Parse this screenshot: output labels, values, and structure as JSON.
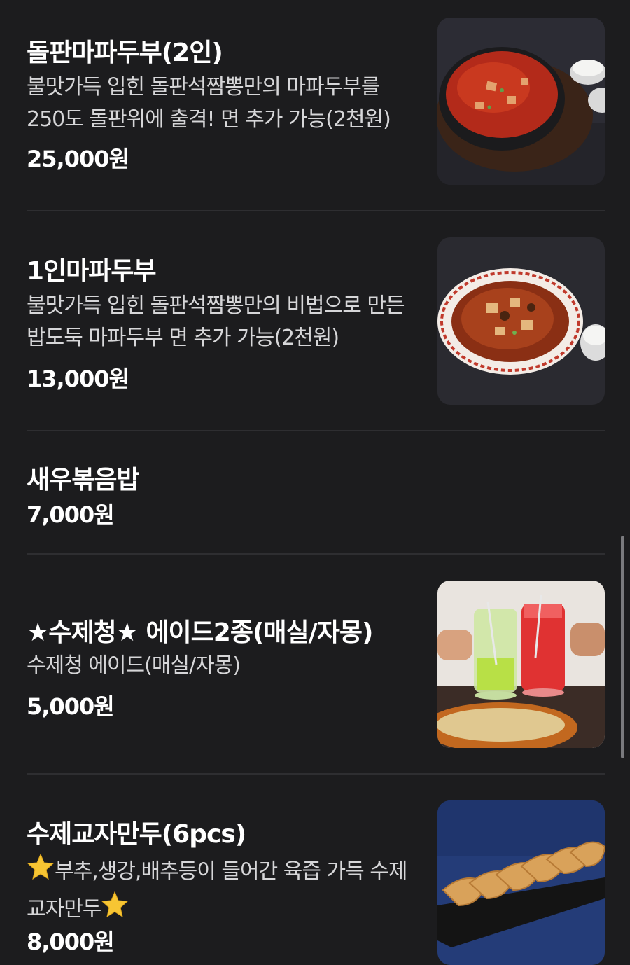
{
  "items": [
    {
      "title": "돌판마파두부(2인)",
      "description": "불맛가득 입힌 돌판석짬뽕만의 마파두부를 250도 돌판위에 출격! 면 추가 가능(2천원)",
      "price": "25,000원",
      "image_icon": "mapo-tofu-stone-pot-photo"
    },
    {
      "title": "1인마파두부",
      "description": "불맛가득 입힌 돌판석짬뽕만의 비법으로 만든 밥도둑 마파두부 면 추가 가능(2천원)",
      "price": "13,000원",
      "image_icon": "mapo-tofu-bowl-photo"
    },
    {
      "title": "새우볶음밥",
      "price": "7,000원"
    },
    {
      "title": "★수제청★ 에이드2종(매실/자몽)",
      "description": "수제청 에이드(매실/자몽)",
      "price": "5,000원",
      "image_icon": "ade-drinks-photo"
    },
    {
      "title": "수제교자만두(6pcs)",
      "description_before": "부추,생강,배추등이 들어간 육즙 가득 수제교자만두",
      "price": "8,000원",
      "image_icon": "dumplings-photo"
    }
  ]
}
